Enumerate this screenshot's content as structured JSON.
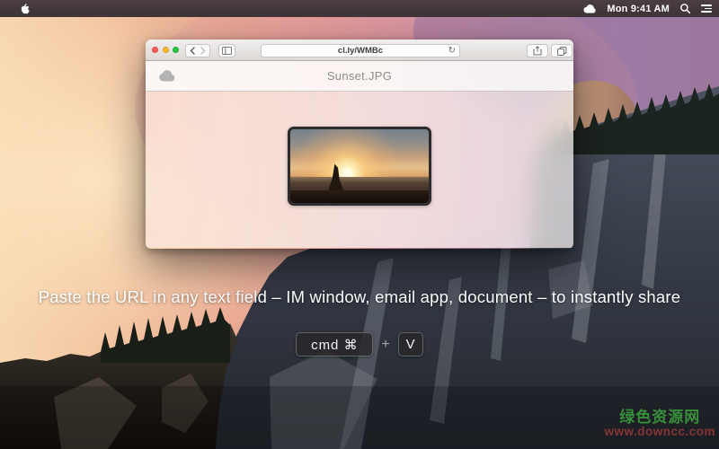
{
  "menu_bar": {
    "clock": "Mon 9:41 AM",
    "icons": [
      "apple-logo",
      "cloudapp-status",
      "spotlight-search",
      "notification-center"
    ]
  },
  "browser": {
    "traffic_lights": [
      "close",
      "minimize",
      "zoom"
    ],
    "url": "cl.ly/WMBc",
    "icons": {
      "back": "chevron-left",
      "forward": "chevron-right",
      "sidebar": "split-panel",
      "refresh": "↻",
      "share": "share-up-arrow",
      "tabs": "overlapping-squares"
    }
  },
  "page": {
    "title": "Sunset.JPG",
    "logo": "cloud"
  },
  "overlay": {
    "hint": "Paste the URL in any text field – IM window, email app, document – to instantly share",
    "key_cmd": "cmd ⌘",
    "plus": "+",
    "key_v": "V"
  },
  "watermark": {
    "line1": "绿色资源网",
    "line2": "www.downcc.com"
  },
  "colors": {
    "traffic_red": "#ff5f57",
    "traffic_yellow": "#febc2e",
    "traffic_green": "#28c840",
    "menubar_bg": "#3e3337",
    "watermark_green": "#3da33d",
    "watermark_red": "#a03a3a",
    "keycap_bg": "rgba(40,39,42,0.82)"
  }
}
